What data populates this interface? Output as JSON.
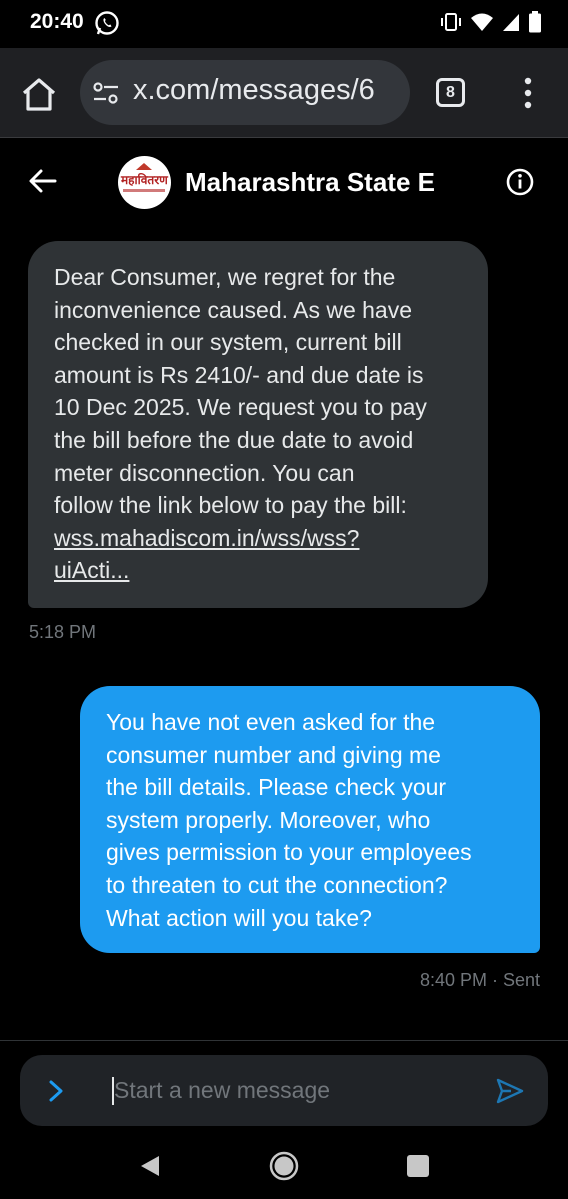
{
  "status_bar": {
    "time": "20:40",
    "icons": [
      "whatsapp-icon",
      "vibrate-icon",
      "wifi-icon",
      "signal-icon",
      "battery-icon"
    ]
  },
  "browser": {
    "url": "x.com/messages/6",
    "tab_count": "8",
    "icons": [
      "home-icon",
      "site-settings-icon",
      "tabs-icon",
      "menu-icon"
    ]
  },
  "conversation": {
    "title": "Maharashtra State E",
    "avatar_text": "महावितरण",
    "icons": [
      "back-arrow-icon",
      "info-icon"
    ]
  },
  "messages": [
    {
      "direction": "incoming",
      "text_lines": [
        "Dear Consumer, we regret for the",
        "inconvenience caused. As we have",
        "checked in our system, current bill",
        "amount is Rs 2410/- and due date is",
        "10 Dec 2025. We request you to pay",
        "the bill before the due date to avoid",
        "meter disconnection. You can",
        "follow the link below to pay the bill:"
      ],
      "link_lines": [
        "wss.mahadiscom.in/wss/wss?",
        "uiActi..."
      ],
      "time": "5:18 PM"
    },
    {
      "direction": "outgoing",
      "text_lines": [
        "You have not even asked for the",
        "consumer number and giving me",
        "the bill details. Please check your",
        "system properly. Moreover, who",
        "gives permission to your employees",
        "to threaten to cut the connection?",
        "What action will you take?"
      ],
      "time": "8:40 PM · Sent"
    }
  ],
  "composer": {
    "placeholder": "Start a new message",
    "icons": [
      "expand-icon",
      "send-icon"
    ]
  },
  "colors": {
    "background": "#000000",
    "incoming_bubble": "#2f3336",
    "outgoing_bubble": "#1d9bf0",
    "muted_text": "#71767b",
    "accent": "#1d9bf0"
  }
}
